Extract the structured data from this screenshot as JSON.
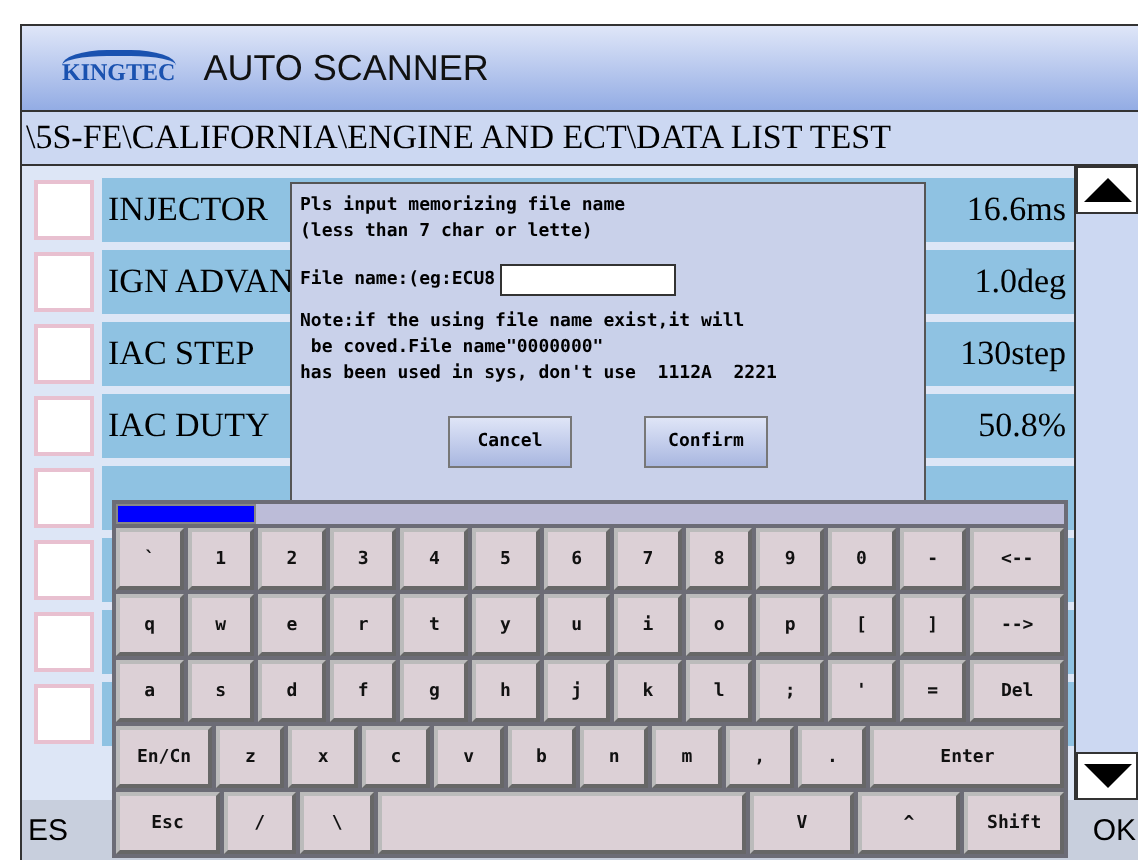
{
  "header": {
    "logo": "KINGTEC",
    "title": "AUTO SCANNER"
  },
  "path": "\\5S-FE\\CALIFORNIA\\ENGINE AND ECT\\DATA LIST TEST",
  "rows": [
    {
      "label": "INJECTOR",
      "value": "16.6ms",
      "checked": false
    },
    {
      "label": "IGN ADVAN",
      "value": "1.0deg",
      "checked": false
    },
    {
      "label": "IAC STEP",
      "value": "130step",
      "checked": false
    },
    {
      "label": "IAC DUTY",
      "value": "50.8%",
      "checked": false
    },
    {
      "checked": false
    },
    {
      "checked": false
    },
    {
      "checked": false
    },
    {
      "checked": false
    }
  ],
  "bottom_bar": {
    "left": "ES",
    "right": "OK"
  },
  "dialog": {
    "prompt": [
      "Pls input memorizing file name",
      "(less than 7 char or lette)"
    ],
    "field_label": "File name:(eg:ECU8",
    "note": [
      "Note:if the using file name exist,it will",
      " be coved.File name\"0000000\"",
      "has been used in sys, don't use  1112A  2221"
    ],
    "buttons": [
      "Cancel",
      "Confirm"
    ]
  },
  "keyboard": {
    "key_rows": [
      {
        "keys": [
          {
            "label": "`",
            "kind": "key"
          },
          {
            "label": "1",
            "kind": "key"
          },
          {
            "label": "2",
            "kind": "key"
          },
          {
            "label": "3",
            "kind": "key"
          },
          {
            "label": "4",
            "kind": "key"
          },
          {
            "label": "5",
            "kind": "key"
          },
          {
            "label": "6",
            "kind": "key"
          },
          {
            "label": "7",
            "kind": "key"
          },
          {
            "label": "8",
            "kind": "key"
          },
          {
            "label": "9",
            "kind": "key"
          },
          {
            "label": "0",
            "kind": "key"
          },
          {
            "label": "-",
            "kind": "key"
          },
          {
            "label": "<--",
            "kind": "wide"
          }
        ]
      },
      {
        "keys": [
          {
            "label": "q",
            "kind": "key"
          },
          {
            "label": "w",
            "kind": "key"
          },
          {
            "label": "e",
            "kind": "key"
          },
          {
            "label": "r",
            "kind": "key"
          },
          {
            "label": "t",
            "kind": "key"
          },
          {
            "label": "y",
            "kind": "key"
          },
          {
            "label": "u",
            "kind": "key"
          },
          {
            "label": "i",
            "kind": "key"
          },
          {
            "label": "o",
            "kind": "key"
          },
          {
            "label": "p",
            "kind": "key"
          },
          {
            "label": "[",
            "kind": "key"
          },
          {
            "label": "]",
            "kind": "key"
          },
          {
            "label": "-->",
            "kind": "wide"
          }
        ]
      },
      {
        "keys": [
          {
            "label": "a",
            "kind": "key"
          },
          {
            "label": "s",
            "kind": "key"
          },
          {
            "label": "d",
            "kind": "key"
          },
          {
            "label": "f",
            "kind": "key"
          },
          {
            "label": "g",
            "kind": "key"
          },
          {
            "label": "h",
            "kind": "key"
          },
          {
            "label": "j",
            "kind": "key"
          },
          {
            "label": "k",
            "kind": "key"
          },
          {
            "label": "l",
            "kind": "key"
          },
          {
            "label": ";",
            "kind": "key"
          },
          {
            "label": "'",
            "kind": "key"
          },
          {
            "label": "=",
            "kind": "key"
          },
          {
            "label": "Del",
            "kind": "wide"
          }
        ]
      },
      {
        "keys": [
          {
            "label": "En/Cn",
            "kind": "wide"
          },
          {
            "label": "z",
            "kind": "key"
          },
          {
            "label": "x",
            "kind": "key"
          },
          {
            "label": "c",
            "kind": "key"
          },
          {
            "label": "v",
            "kind": "key"
          },
          {
            "label": "b",
            "kind": "key"
          },
          {
            "label": "n",
            "kind": "key"
          },
          {
            "label": "m",
            "kind": "key"
          },
          {
            "label": ",",
            "kind": "key"
          },
          {
            "label": ".",
            "kind": "key"
          },
          {
            "label": "Enter",
            "kind": "enter"
          }
        ]
      },
      {
        "keys": [
          {
            "label": "Esc",
            "kind": "wide"
          },
          {
            "label": "/",
            "kind": "key"
          },
          {
            "label": "\\",
            "kind": "key"
          },
          {
            "kind": "space"
          },
          {
            "label": "V",
            "kind": "wide"
          },
          {
            "label": "^",
            "kind": "wide"
          },
          {
            "label": "Shift",
            "kind": "wide"
          }
        ]
      }
    ]
  }
}
